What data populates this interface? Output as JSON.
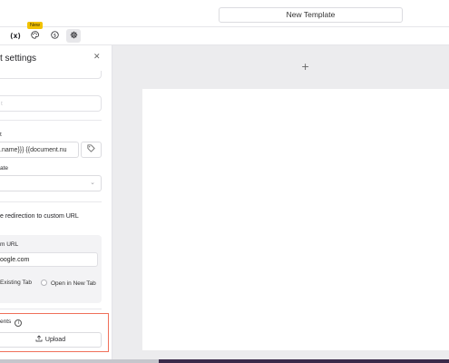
{
  "header": {
    "template_name": "New Template"
  },
  "toolbar": {
    "variables_label": "(x)",
    "new_badge": "New",
    "palette_icon": "palette-icon",
    "dollar_icon": "dollar-icon",
    "gear_icon": "gear-icon"
  },
  "panel": {
    "title": "t settings",
    "close_glyph": "✕",
    "dim_field_text": "t",
    "filename_label": "t",
    "filename_value": ".name}}} {{document.nu",
    "tag_icon": "tag-icon",
    "select_label": "ate",
    "toggle_label": "e redirection to custom URL",
    "custom_url_label": "m URL",
    "custom_url_value": "oogle.com",
    "radio_existing": "Existing Tab",
    "radio_new": "Open in New Tab",
    "attachments_label": "ents",
    "upload_label": "Upload"
  },
  "canvas": {
    "add_glyph": "+"
  },
  "colors": {
    "highlight_border": "#f0705a",
    "badge": "#f2c200"
  }
}
